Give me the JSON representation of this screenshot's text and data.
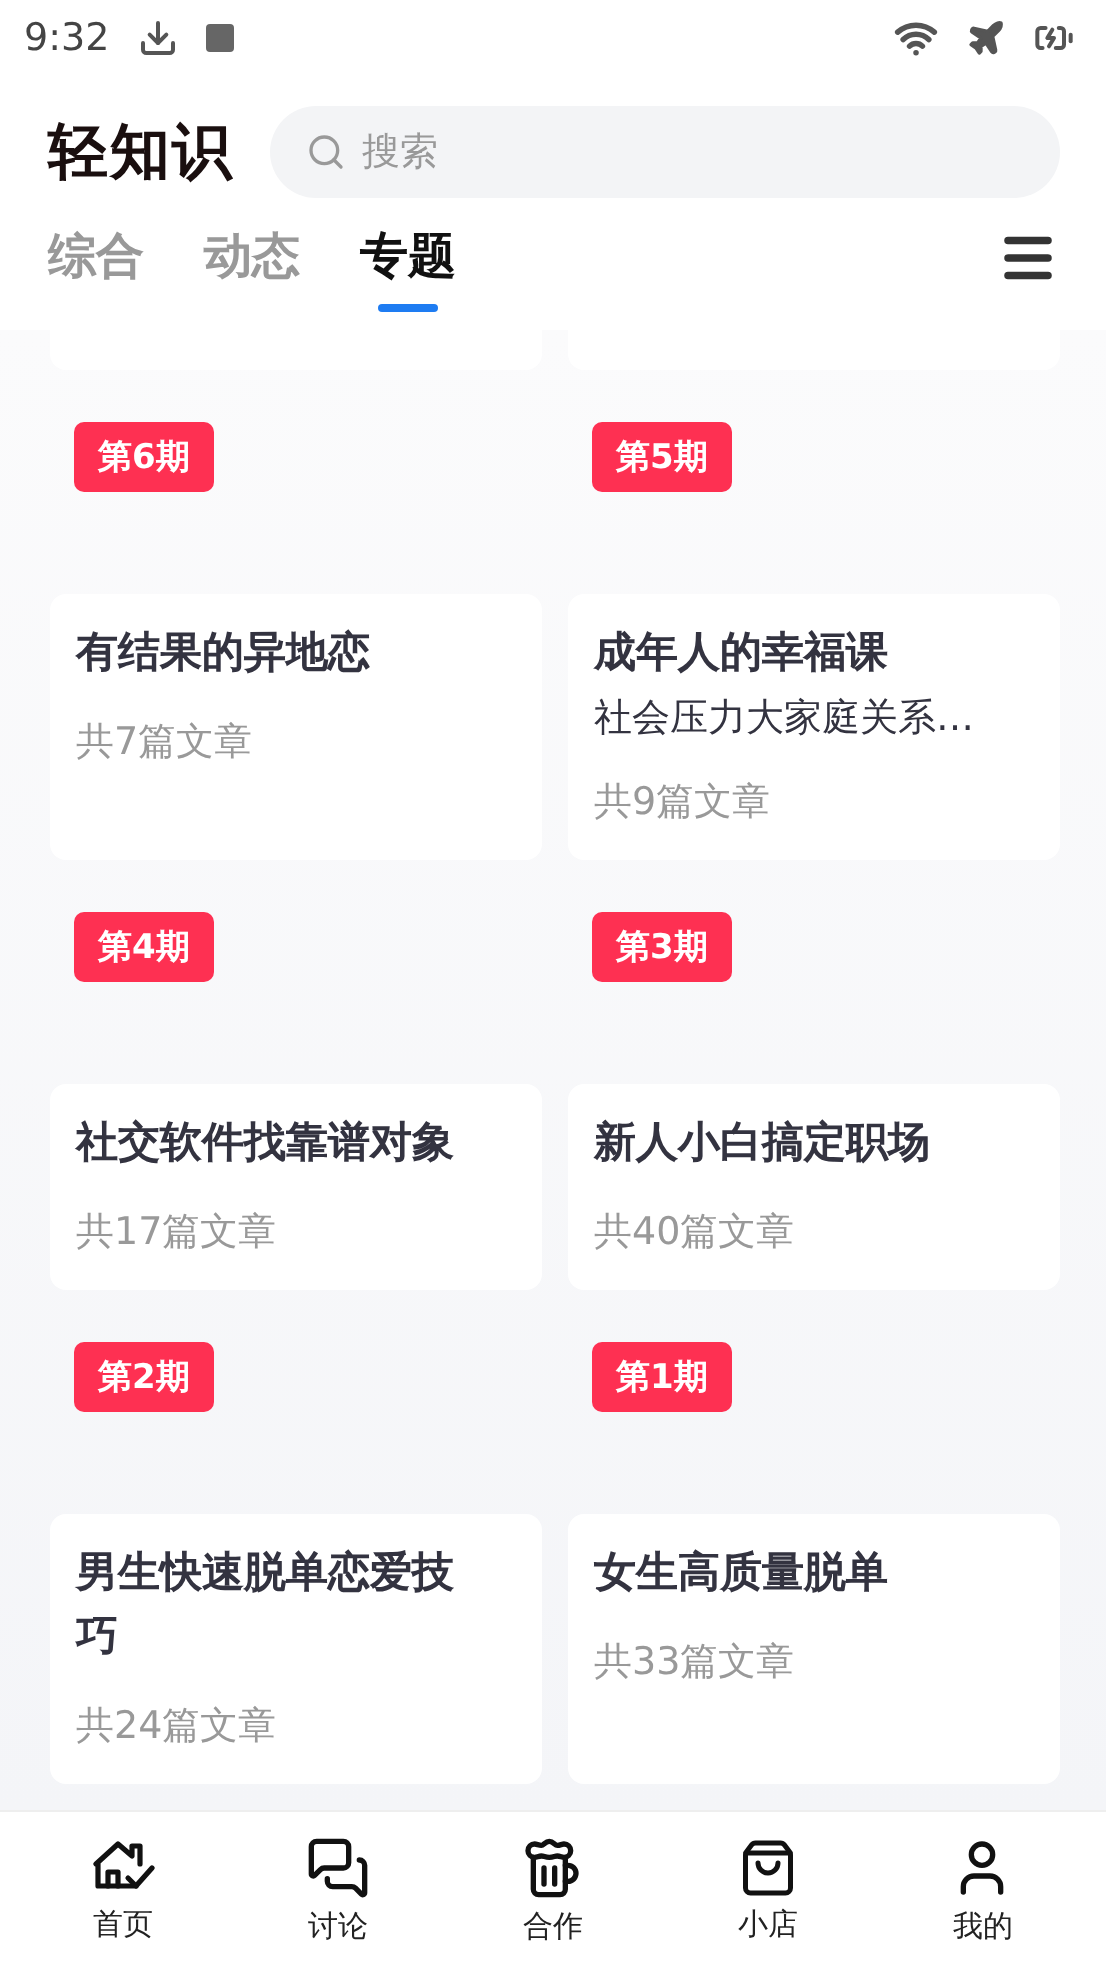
{
  "status_bar": {
    "time": "9:32"
  },
  "header": {
    "logo": "轻知识",
    "search": {
      "placeholder": "搜索"
    }
  },
  "tabs": [
    {
      "label": "综合",
      "selected": false
    },
    {
      "label": "动态",
      "selected": false
    },
    {
      "label": "专题",
      "selected": true
    }
  ],
  "topics": [
    {
      "badge": "第6期",
      "title": "有结果的异地恋",
      "count": "共7篇文章"
    },
    {
      "badge": "第5期",
      "title": "成年人的幸福课",
      "subtitle": "社会压力大家庭关系…",
      "count": "共9篇文章"
    },
    {
      "badge": "第4期",
      "title": "社交软件找靠谱对象",
      "count": "共17篇文章"
    },
    {
      "badge": "第3期",
      "title": "新人小白搞定职场",
      "count": "共40篇文章"
    },
    {
      "badge": "第2期",
      "title": "男生快速脱单恋爱技巧",
      "count": "共24篇文章"
    },
    {
      "badge": "第1期",
      "title": "女生高质量脱单",
      "count": "共33篇文章"
    }
  ],
  "bottom_nav": [
    {
      "label": "首页"
    },
    {
      "label": "讨论"
    },
    {
      "label": "合作"
    },
    {
      "label": "小店"
    },
    {
      "label": "我的"
    }
  ]
}
